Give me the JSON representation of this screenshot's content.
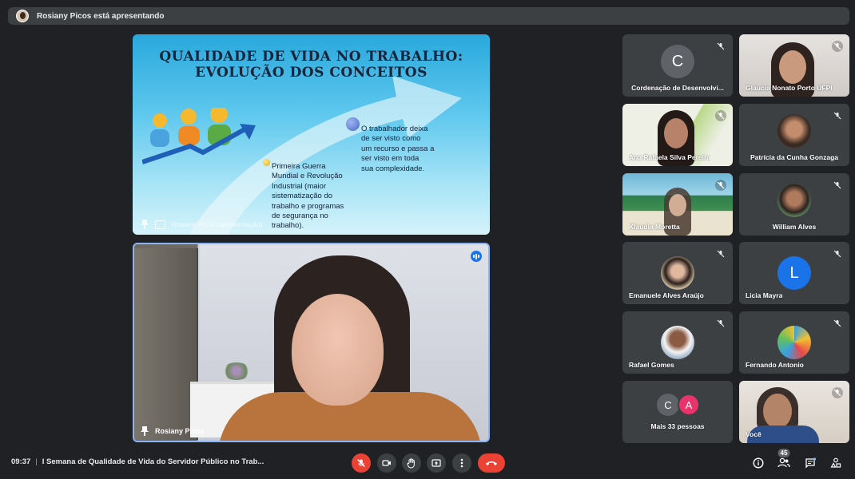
{
  "presenting_banner": {
    "text": "Rosiany Picos está apresentando"
  },
  "slide": {
    "title_line1": "QUALIDADE DE VIDA NO TRABALHO:",
    "title_line2": "EVOLUÇÃO DOS CONCEITOS",
    "point1": [
      "Primeira Guerra",
      "Mundial e Revolução",
      "Industrial (maior",
      "sistematização do",
      "trabalho e programas",
      "de segurança no",
      "trabalho)."
    ],
    "point2": [
      "O trabalhador deixa",
      "de ser visto como",
      "um recurso e passa a",
      "ser visto em toda",
      "sua complexidade."
    ],
    "overlay_label": "Rosiany Picos (apresentação)"
  },
  "presenter": {
    "name": "Rosiany Picos"
  },
  "tiles": [
    {
      "name": "Cordenação de Desenvolvi...",
      "initial": "C",
      "color": "#5f6368"
    },
    {
      "name": "Glaucia Nonato Porto UFPI"
    },
    {
      "name": "Ana Rafaela Silva Pereira"
    },
    {
      "name": "Patrícia da Cunha Gonzaga"
    },
    {
      "name": "Klaudia Moretta"
    },
    {
      "name": "William Alves"
    },
    {
      "name": "Emanuele Alves Araújo"
    },
    {
      "name": "Licia Mayra",
      "initial": "L",
      "color": "#1a73e8"
    },
    {
      "name": "Rafael Gomes"
    },
    {
      "name": "Fernando Antonio"
    },
    {
      "name": "Mais 33 pessoas",
      "initials": [
        "C",
        "A"
      ],
      "colors": [
        "#5f6368",
        "#e8336b"
      ]
    },
    {
      "name": "Você"
    }
  ],
  "bottom": {
    "time": "09:37",
    "meeting_title": "I Semana de Qualidade de Vida do Servidor Público no Trab...",
    "participants_count": "45"
  }
}
